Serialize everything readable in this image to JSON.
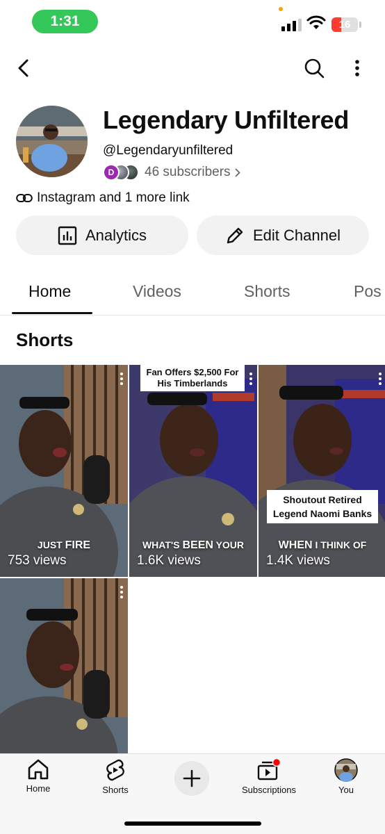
{
  "status_bar": {
    "time": "1:31",
    "battery": "16"
  },
  "top_nav": {
    "back": "back-icon",
    "search": "search-icon",
    "more": "more-vert-icon"
  },
  "channel": {
    "name": "Legendary Unfiltered",
    "handle": "@Legendaryunfiltered",
    "subscriber_avatar_initial": "D",
    "subscribers": "46 subscribers",
    "links": "Instagram and 1 more link"
  },
  "actions": {
    "analytics": "Analytics",
    "edit": "Edit Channel"
  },
  "tabs": [
    {
      "label": "Home",
      "active": true
    },
    {
      "label": "Videos"
    },
    {
      "label": "Shorts"
    },
    {
      "label": "Pos"
    }
  ],
  "section_title": "Shorts",
  "shorts": [
    {
      "views": "753 views",
      "caption_plain": "JUST",
      "caption_bold": "FIRE"
    },
    {
      "views": "1.6K views",
      "banner": "Fan Offers $2,500 For His Timberlands",
      "caption_plain": "WHAT'S",
      "caption_bold": "BEEN",
      "caption_tail": "YOUR"
    },
    {
      "views": "1.4K views",
      "banner": "Shoutout Retired Legend Naomi Banks",
      "caption_bold": "WHEN",
      "caption_tail": "I THINK OF"
    },
    {
      "views": ""
    }
  ],
  "bottom_nav": [
    {
      "label": "Home",
      "icon": "home-icon"
    },
    {
      "label": "Shorts",
      "icon": "shorts-icon"
    },
    {
      "label": "",
      "icon": "create-icon"
    },
    {
      "label": "Subscriptions",
      "icon": "subscriptions-icon"
    },
    {
      "label": "You",
      "icon": "profile-avatar"
    }
  ],
  "colors": {
    "status_green": "#34c759",
    "battery_red": "#ff3b30",
    "notification_red": "#ff0000",
    "text": "#0f0f0f",
    "secondary_text": "#606060",
    "button_bg": "#f2f2f2"
  }
}
